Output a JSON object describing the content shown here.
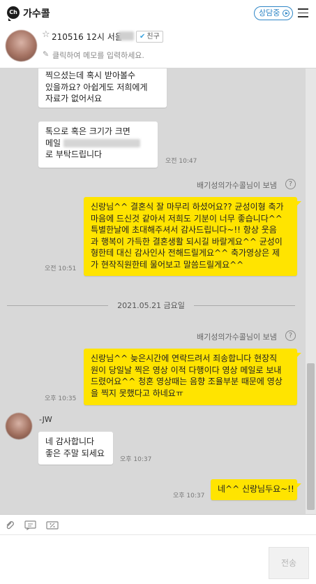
{
  "header": {
    "logo_text": "Ch",
    "app_title": "가수콜",
    "status_label": "상담중",
    "menu_icon": "hamburger-icon"
  },
  "profile": {
    "customer_name": "210516 12시 서울",
    "friend_badge": "친구",
    "memo_placeholder": "클릭하여 메모를 입력하세요."
  },
  "messages": [
    {
      "line1": "찍으셨는데 혹시 받아볼수",
      "line2": "있을까요? 아쉽게도 저희에게",
      "line3": "자료가 없어서요"
    },
    {
      "line1": "톡으로 혹은 크기가 크면",
      "line2": "메일",
      "line3": "로 부탁드립니다",
      "time": "오전 10:47"
    },
    {
      "sender": "배기성의가수콜님이 보냄",
      "time": "오전 10:51",
      "line1": "신랑님^^ 결혼식 잘 마무리 하셨어요?? 균성이형 축가",
      "line2": "마음에 드신것 같아서 저희도 기분이 너무 좋습니다^^",
      "line3": "특별한날에 초대해주셔서 감사드립니다~!! 항상 웃음",
      "line4": "과 행복이 가득한 결혼생활 되시길 바랄게요^^ 균성이",
      "line5": "형한테 대신 감사인사 전해드릴게요^^ 축가영상은 제",
      "line6": "가 현작직원한테 물어보고 말씀드릴게요^^"
    },
    {
      "date": "2021.05.21 금요일"
    },
    {
      "sender": "배기성의가수콜님이 보냄",
      "time": "오후 10:35",
      "line1": "신랑님^^ 늦은시간에 연락드려서 죄송합니다 현장직",
      "line2": "원이 당일날 찍은 영상 이적 다행이다 영상 메일로 보내",
      "line3": "드렸어요^^ 청혼 영상때는 음향 조율부분 때문에 영상",
      "line4": "을 찍지 못했다고 하네요ㅠ"
    },
    {
      "peer_name": "-JW",
      "line1": "네 감사합니다",
      "line2": "좋은 주말 되세요",
      "time": "오후 10:37"
    },
    {
      "time": "오후 10:37",
      "text": "네^^ 신랑님두요~!!"
    }
  ],
  "toolbar": {
    "attach_icon": "paperclip-icon",
    "quick_reply_icon": "quick-reply-icon",
    "coupon_icon": "coupon-icon"
  },
  "composer": {
    "send_label": "전송"
  }
}
